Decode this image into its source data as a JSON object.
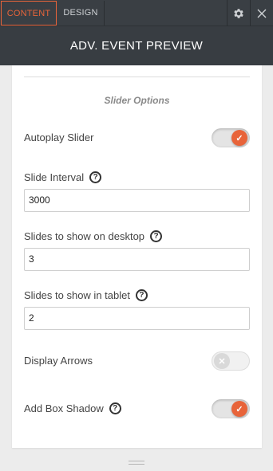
{
  "tabs": {
    "content": "CONTENT",
    "design": "DESIGN"
  },
  "icons": {
    "settings": "gear-icon",
    "close": "close-icon"
  },
  "header": {
    "title": "ADV. EVENT PREVIEW"
  },
  "section": {
    "title": "Slider Options"
  },
  "fields": {
    "autoplay": {
      "label": "Autoplay Slider",
      "checked": true
    },
    "interval": {
      "label": "Slide Interval",
      "value": "3000"
    },
    "desktop": {
      "label": "Slides to show on desktop",
      "value": "3"
    },
    "tablet": {
      "label": "Slides to show in tablet",
      "value": "2"
    },
    "arrows": {
      "label": "Display Arrows",
      "checked": false
    },
    "shadow": {
      "label": "Add Box Shadow",
      "checked": true
    }
  },
  "colors": {
    "accent": "#e8643a",
    "topbar": "#3a3f44",
    "header": "#383d42"
  }
}
